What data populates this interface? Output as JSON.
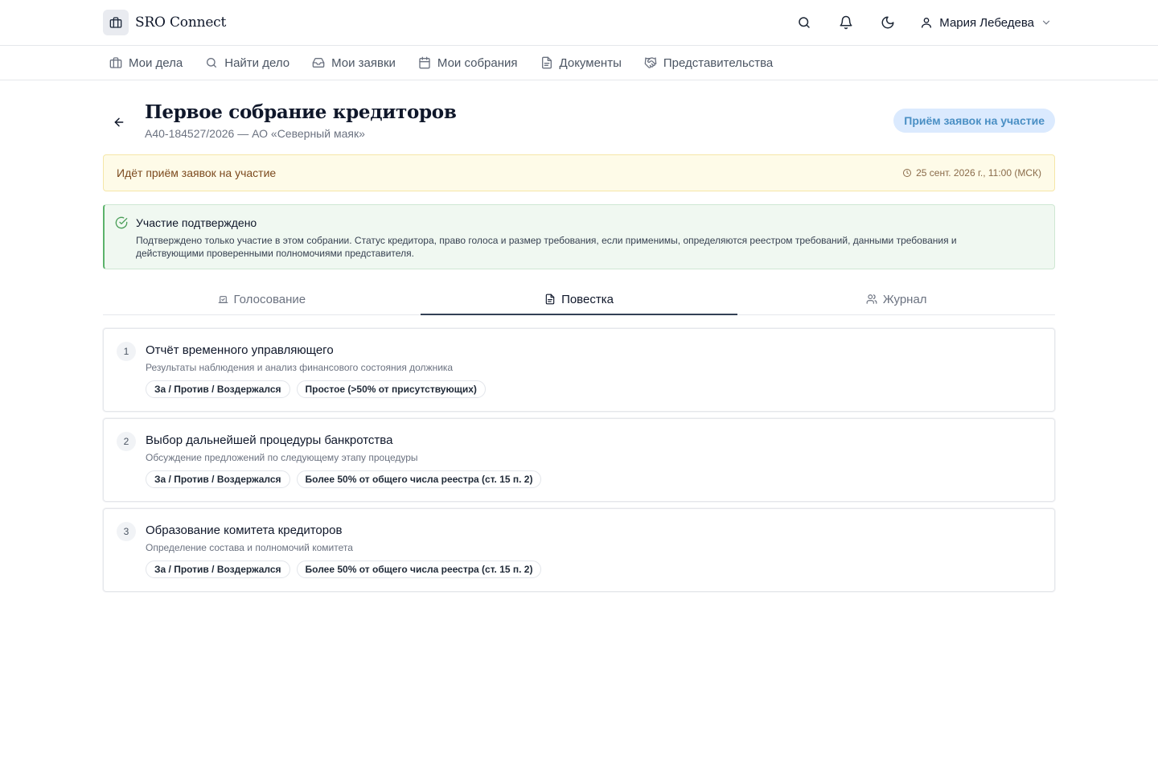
{
  "app": {
    "name": "SRO Connect"
  },
  "header": {
    "user_name": "Мария Лебедева"
  },
  "nav": {
    "items": [
      {
        "label": "Мои дела",
        "icon": "briefcase-icon"
      },
      {
        "label": "Найти дело",
        "icon": "search-icon"
      },
      {
        "label": "Мои заявки",
        "icon": "inbox-icon"
      },
      {
        "label": "Мои собрания",
        "icon": "calendar-icon"
      },
      {
        "label": "Документы",
        "icon": "document-icon"
      },
      {
        "label": "Представительства",
        "icon": "handshake-icon"
      }
    ]
  },
  "page": {
    "title": "Первое собрание кредиторов",
    "subtitle": "А40-184527/2026 — АО «Северный маяк»",
    "status": "Приём заявок на участие"
  },
  "notice": {
    "text": "Идёт приём заявок на участие",
    "date": "25 сент. 2026 г., 11:00 (МСК)"
  },
  "confirmation": {
    "title": "Участие подтверждено",
    "text": "Подтверждено только участие в этом собрании. Статус кредитора, право голоса и размер требования, если применимы, определяются реестром требований, данными требования и действующими проверенными полномочиями представителя."
  },
  "tabs": [
    {
      "label": "Голосование",
      "icon": "ballot-icon",
      "active": false
    },
    {
      "label": "Повестка",
      "icon": "document-icon",
      "active": true
    },
    {
      "label": "Журнал",
      "icon": "users-icon",
      "active": false
    }
  ],
  "agenda": [
    {
      "number": "1",
      "title": "Отчёт временного управляющего",
      "description": "Результаты наблюдения и анализ финансового состояния должника",
      "chips": [
        "За / Против / Воздержался",
        "Простое (>50% от присутствующих)"
      ]
    },
    {
      "number": "2",
      "title": "Выбор дальнейшей процедуры банкротства",
      "description": "Обсуждение предложений по следующему этапу процедуры",
      "chips": [
        "За / Против / Воздержался",
        "Более 50% от общего числа реестра (ст. 15 п. 2)"
      ]
    },
    {
      "number": "3",
      "title": "Образование комитета кредиторов",
      "description": "Определение состава и полномочий комитета",
      "chips": [
        "За / Против / Воздержался",
        "Более 50% от общего числа реестра (ст. 15 п. 2)"
      ]
    }
  ],
  "colors": {
    "status_pill_bg": "#dbeafe",
    "status_pill_text": "#4a8fc4",
    "notice_bg": "#fefbe8",
    "confirm_bg": "#f0f8f1",
    "confirm_accent": "#5cb36b"
  }
}
